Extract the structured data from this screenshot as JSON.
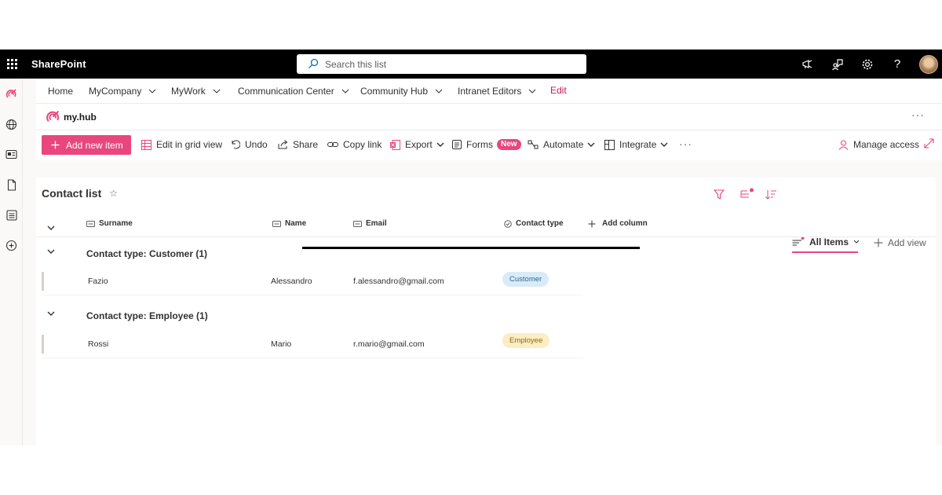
{
  "suitebar": {
    "app_name": "SharePoint",
    "search_placeholder": "Search this list",
    "icons": [
      "megaphone-icon",
      "feedback-icon",
      "gear-icon",
      "help-icon",
      "avatar"
    ]
  },
  "rail": {
    "icons": [
      "myhub-logo-icon",
      "globe-icon",
      "news-icon",
      "document-icon",
      "list-icon",
      "add-circle-icon"
    ]
  },
  "hubnav": {
    "items": [
      {
        "label": "Home",
        "dropdown": false
      },
      {
        "label": "MyCompany",
        "dropdown": true
      },
      {
        "label": "MyWork",
        "dropdown": true
      },
      {
        "label": "Communication Center",
        "dropdown": true
      },
      {
        "label": "Community Hub",
        "dropdown": true
      },
      {
        "label": "Intranet Editors",
        "dropdown": true
      }
    ],
    "edit_label": "Edit"
  },
  "site": {
    "logo_text": "my.hub",
    "more": "···"
  },
  "commandbar": {
    "add_new_item": "Add new item",
    "edit_grid": "Edit in grid view",
    "undo": "Undo",
    "share": "Share",
    "copy_link": "Copy link",
    "export": "Export",
    "forms": "Forms",
    "forms_badge": "New",
    "automate": "Automate",
    "integrate": "Integrate",
    "more": "···",
    "manage_access": "Manage access"
  },
  "list": {
    "title": "Contact list",
    "star": "☆",
    "view_name": "All Items",
    "add_view": "Add view"
  },
  "columns": {
    "surname": "Surname",
    "name": "Name",
    "email": "Email",
    "contact_type": "Contact type",
    "add_column": "Add column"
  },
  "groups": [
    {
      "title": "Contact type: Customer (1)",
      "rows": [
        {
          "surname": "Fazio",
          "name": "Alessandro",
          "email": "f.alessandro@gmail.com",
          "contact_type": "Customer"
        }
      ]
    },
    {
      "title": "Contact type: Employee (1)",
      "rows": [
        {
          "surname": "Rossi",
          "name": "Mario",
          "email": "r.mario@gmail.com",
          "contact_type": "Employee"
        }
      ]
    }
  ],
  "colors": {
    "suitebar_bg": "#000000",
    "accent_pink": "#e8467c",
    "customer_pill_bg": "#d9ebf7",
    "customer_pill_text": "#2b6a96",
    "employee_pill_bg": "#fdedc4",
    "employee_pill_text": "#8a6a10"
  }
}
